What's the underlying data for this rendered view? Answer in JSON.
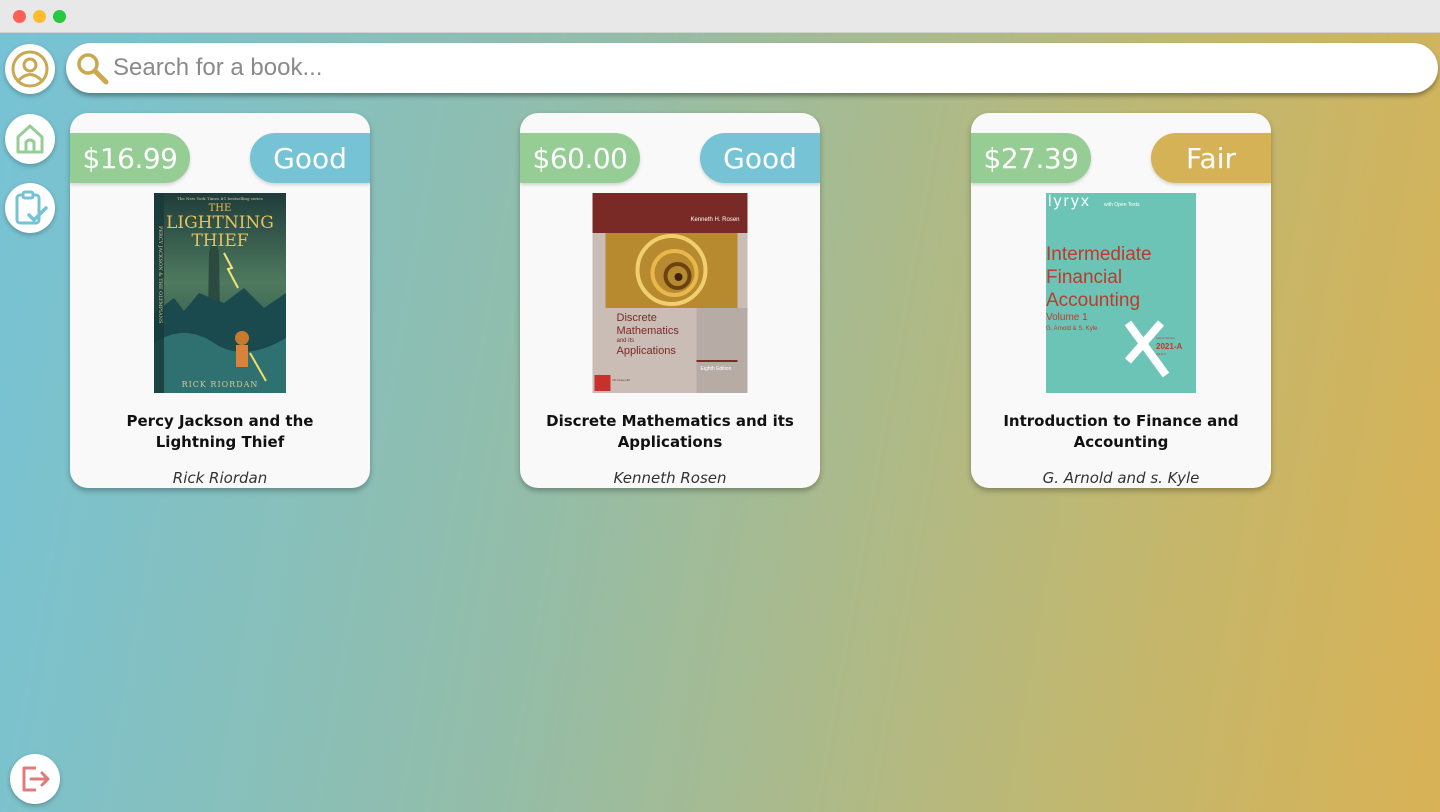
{
  "window": {
    "controls": [
      "close",
      "minimize",
      "maximize"
    ]
  },
  "sidebar": {
    "items": [
      {
        "name": "profile",
        "icon": "user-circle-icon",
        "color": "#c9a84f"
      },
      {
        "name": "home",
        "icon": "home-icon",
        "color": "#95cd95"
      },
      {
        "name": "orders",
        "icon": "clipboard-check-icon",
        "color": "#76c3d6"
      }
    ],
    "logout": {
      "icon": "logout-icon",
      "color": "#e07b7b"
    }
  },
  "search": {
    "placeholder": "Search for a book...",
    "value": ""
  },
  "colors": {
    "price_bg": "#95cd95",
    "condition_good": "#76c3d6",
    "condition_fair": "#d4b255"
  },
  "books": [
    {
      "price": "$16.99",
      "condition": "Good",
      "title": "Percy Jackson and the Lightning Thief",
      "author": "Rick Riordan",
      "cover": {
        "line1": "THE",
        "line2": "LIGHTNING",
        "line3": "THIEF",
        "author": "RICK RIORDAN",
        "spine": "PERCY JACKSON & THE OLYMPIANS",
        "tagline": "The New York Times #1 bestselling series"
      }
    },
    {
      "price": "$60.00",
      "condition": "Good",
      "title": "Discrete Mathematics and its Applications",
      "author": "Kenneth Rosen",
      "cover": {
        "author": "Kenneth H. Rosen",
        "line1": "Discrete",
        "line2": "Mathematics",
        "line3": "and its",
        "line4": "Applications",
        "edition": "Eighth Edition",
        "publisher": "Mc Graw Hill"
      }
    },
    {
      "price": "$27.39",
      "condition": "Fair",
      "title": "Introduction to Finance and Accounting",
      "author": "G. Arnold and s. Kyle",
      "cover": {
        "brand": "lyryx",
        "brand_sub": "with Open Texts",
        "line1": "Intermediate",
        "line2": "Financial",
        "line3": "Accounting",
        "volume": "Volume 1",
        "authors": "G. Arnold & S. Kyle",
        "version_label": "Latest Version",
        "version": "2021-A",
        "version_sub": "(32 ET)"
      }
    }
  ]
}
